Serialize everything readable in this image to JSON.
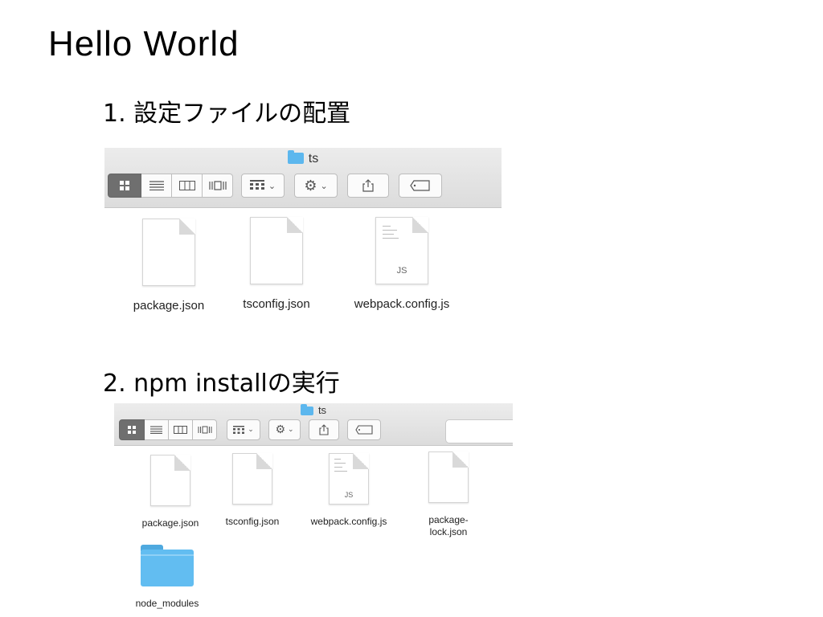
{
  "slide_title": "Hello World",
  "sections": [
    {
      "heading": "1. 設定ファイルの配置",
      "window_title": "ts",
      "files": [
        {
          "name": "package.json",
          "icon": "document-icon"
        },
        {
          "name": "tsconfig.json",
          "icon": "document-icon"
        },
        {
          "name": "webpack.config.js",
          "icon": "js-document-icon",
          "badge": "JS"
        }
      ]
    },
    {
      "heading": "2. npm installの実行",
      "window_title": "ts",
      "files": [
        {
          "name": "package.json",
          "icon": "document-icon"
        },
        {
          "name": "tsconfig.json",
          "icon": "document-icon"
        },
        {
          "name": "webpack.config.js",
          "icon": "js-document-icon",
          "badge": "JS"
        },
        {
          "name": "package-\nlock.json",
          "icon": "document-icon"
        },
        {
          "name": "node_modules",
          "icon": "folder-icon"
        }
      ]
    }
  ],
  "toolbar_icons": {
    "view_icon": "icon-view-icon",
    "list_view": "list-view-icon",
    "column_view": "column-view-icon",
    "coverflow_view": "coverflow-view-icon",
    "arrange": "arrange-icon",
    "action": "gear-icon",
    "share": "share-icon",
    "tags": "tag-icon"
  },
  "colors": {
    "folder_blue": "#5cb7ee",
    "active_segment": "#6f6f6f"
  }
}
